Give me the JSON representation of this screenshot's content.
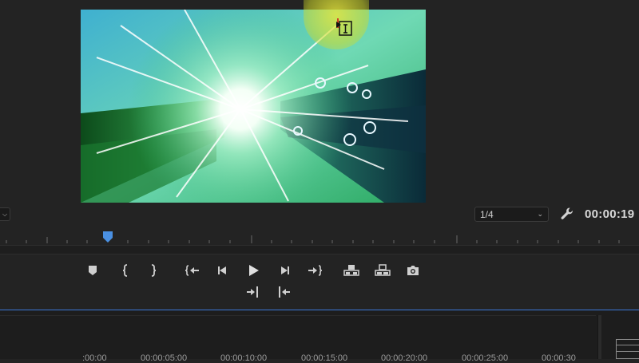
{
  "monitor": {
    "resolution_value": "1/4",
    "timecode": "00:00:19"
  },
  "timeline": {
    "ruler_labels": [
      ":00:00",
      "00:00:05:00",
      "00:00:10:00",
      "00:00:15:00",
      "00:00:20:00",
      "00:00:25:00",
      "00:00:30"
    ]
  },
  "controls": {
    "row1": [
      "add-marker",
      "mark-in",
      "mark-out",
      "go-to-in",
      "step-back",
      "play",
      "step-forward",
      "go-to-out",
      "lift",
      "extract",
      "export-frame"
    ],
    "row2": [
      "insert",
      "overwrite"
    ]
  },
  "colors": {
    "accent_blue": "#3b78d8",
    "panel_bg": "#232323",
    "playhead": "#4a90e2"
  }
}
